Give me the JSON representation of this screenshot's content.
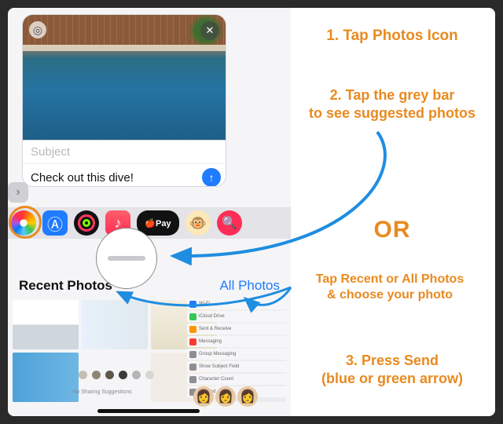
{
  "compose": {
    "subject_placeholder": "Subject",
    "message_text": "Check out this dive!"
  },
  "drawer": {
    "applepay_label": "🍎Pay"
  },
  "photos_section": {
    "recent_label": "Recent Photos",
    "all_label": "All Photos",
    "no_sharing": "No Sharing Suggestions"
  },
  "instructions": {
    "step1": "1. Tap Photos Icon",
    "step2a": "2. Tap the grey bar",
    "step2b": "to see suggested photos",
    "or": "OR",
    "step_alt_a": "Tap Recent or All Photos",
    "step_alt_b": "& choose your photo",
    "step3a": "3. Press Send",
    "step3b": "(blue or green arrow)"
  },
  "colors": {
    "accent_orange": "#e98a1f",
    "arrow_blue": "#1f8de0",
    "ios_blue": "#1f7bff"
  }
}
